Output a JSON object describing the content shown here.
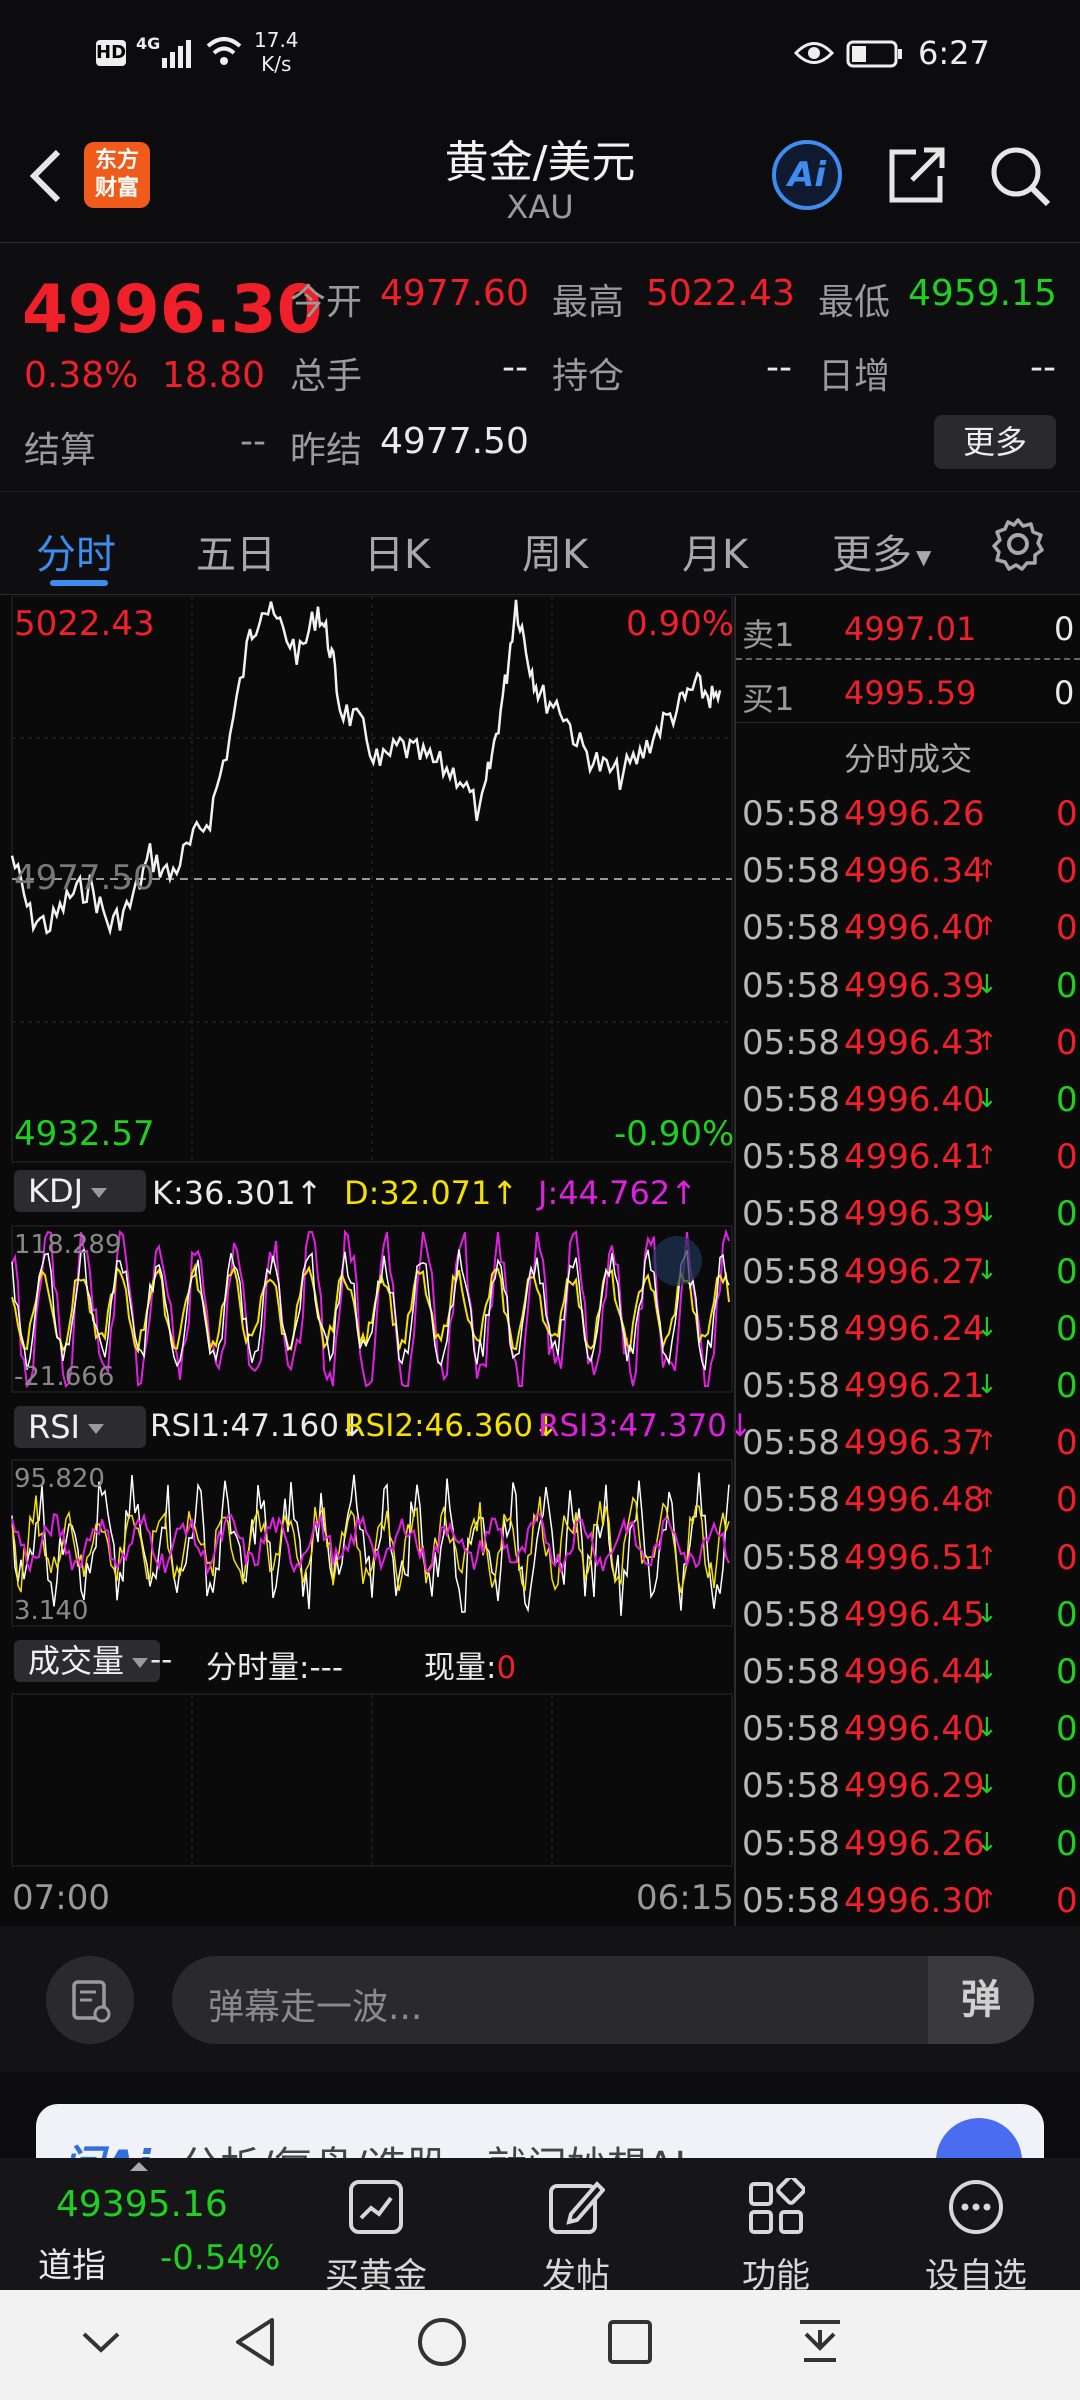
{
  "status": {
    "network": "4G",
    "speed_value": "17.4",
    "speed_unit": "K/s",
    "time": "6:27",
    "hd": "HD"
  },
  "header": {
    "title": "黄金/美元",
    "subtitle": "XAU",
    "logo_line1": "东方",
    "logo_line2": "财富",
    "ai_label": "Ai"
  },
  "quote": {
    "price": "4996.30",
    "change_pct": "0.38%",
    "change_abs": "18.80",
    "open_label": "今开",
    "open": "4977.60",
    "high_label": "最高",
    "high": "5022.43",
    "low_label": "最低",
    "low": "4959.15",
    "volume_label": "总手",
    "volume": "--",
    "position_label": "持仓",
    "position": "--",
    "daily_inc_label": "日增",
    "daily_inc": "--",
    "settle_label": "结算",
    "settle": "--",
    "prev_settle_label": "昨结",
    "prev_settle": "4977.50",
    "more_button": "更多"
  },
  "tabs": [
    "分时",
    "五日",
    "日K",
    "周K",
    "月K",
    "更多"
  ],
  "chart": {
    "max_price": "5022.43",
    "max_pct": "0.90%",
    "min_price": "4932.57",
    "min_pct": "-0.90%",
    "ref_price": "4977.50",
    "time_start": "07:00",
    "time_end": "06:15"
  },
  "kdj": {
    "label": "KDJ",
    "k": "K:36.301",
    "d": "D:32.071",
    "j": "J:44.762",
    "max": "118.289",
    "min": "-21.666"
  },
  "rsi": {
    "label": "RSI",
    "rsi1": "RSI1:47.160",
    "rsi2": "RSI2:46.360",
    "rsi3": "RSI3:47.370",
    "max": "95.820",
    "min": "3.140"
  },
  "volume_panel": {
    "label": "成交量",
    "dash": "--",
    "fs_label": "分时量:---",
    "now_label": "现量:",
    "now_value": "0"
  },
  "orderbook": {
    "sell_label": "卖1",
    "sell_price": "4997.01",
    "sell_qty": "0",
    "buy_label": "买1",
    "buy_price": "4995.59",
    "buy_qty": "0",
    "trades_title": "分时成交"
  },
  "trades": [
    {
      "time": "05:58",
      "price": "4996.26",
      "arrow": "",
      "qty": "0",
      "dir": "up"
    },
    {
      "time": "05:58",
      "price": "4996.34",
      "arrow": "↑",
      "qty": "0",
      "dir": "up"
    },
    {
      "time": "05:58",
      "price": "4996.40",
      "arrow": "↑",
      "qty": "0",
      "dir": "up"
    },
    {
      "time": "05:58",
      "price": "4996.39",
      "arrow": "↓",
      "qty": "0",
      "dir": "down"
    },
    {
      "time": "05:58",
      "price": "4996.43",
      "arrow": "↑",
      "qty": "0",
      "dir": "up"
    },
    {
      "time": "05:58",
      "price": "4996.40",
      "arrow": "↓",
      "qty": "0",
      "dir": "down"
    },
    {
      "time": "05:58",
      "price": "4996.41",
      "arrow": "↑",
      "qty": "0",
      "dir": "up"
    },
    {
      "time": "05:58",
      "price": "4996.39",
      "arrow": "↓",
      "qty": "0",
      "dir": "down"
    },
    {
      "time": "05:58",
      "price": "4996.27",
      "arrow": "↓",
      "qty": "0",
      "dir": "down"
    },
    {
      "time": "05:58",
      "price": "4996.24",
      "arrow": "↓",
      "qty": "0",
      "dir": "down"
    },
    {
      "time": "05:58",
      "price": "4996.21",
      "arrow": "↓",
      "qty": "0",
      "dir": "down"
    },
    {
      "time": "05:58",
      "price": "4996.37",
      "arrow": "↑",
      "qty": "0",
      "dir": "up"
    },
    {
      "time": "05:58",
      "price": "4996.48",
      "arrow": "↑",
      "qty": "0",
      "dir": "up"
    },
    {
      "time": "05:58",
      "price": "4996.51",
      "arrow": "↑",
      "qty": "0",
      "dir": "up"
    },
    {
      "time": "05:58",
      "price": "4996.45",
      "arrow": "↓",
      "qty": "0",
      "dir": "down"
    },
    {
      "time": "05:58",
      "price": "4996.44",
      "arrow": "↓",
      "qty": "0",
      "dir": "down"
    },
    {
      "time": "05:58",
      "price": "4996.40",
      "arrow": "↓",
      "qty": "0",
      "dir": "down"
    },
    {
      "time": "05:58",
      "price": "4996.29",
      "arrow": "↓",
      "qty": "0",
      "dir": "down"
    },
    {
      "time": "05:58",
      "price": "4996.26",
      "arrow": "↓",
      "qty": "0",
      "dir": "down"
    },
    {
      "time": "05:58",
      "price": "4996.30",
      "arrow": "↑",
      "qty": "0",
      "dir": "up"
    }
  ],
  "danmaku": {
    "placeholder": "弹幕走一波...",
    "toggle": "弹"
  },
  "banner": {
    "brand": "问Ai",
    "text": "分析/复盘/选股，就问妙想AI"
  },
  "bottom": {
    "index_value": "49395.16",
    "index_name": "道指",
    "index_change": "-0.54%",
    "items": [
      "买黄金",
      "发帖",
      "功能",
      "设自选"
    ]
  },
  "colors": {
    "up": "#f0202a",
    "down": "#1fd01f",
    "accent": "#3d8cf0",
    "k_line": "#ffffff",
    "d_line": "#f5e000",
    "j_line": "#e020e0"
  }
}
